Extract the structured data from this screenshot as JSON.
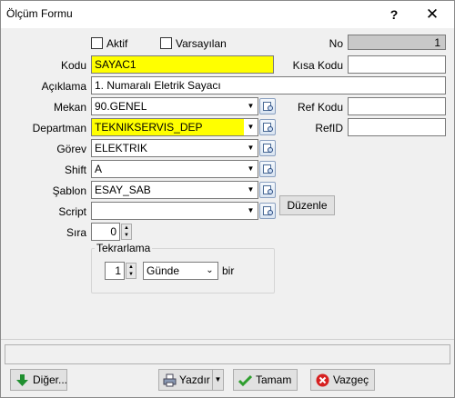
{
  "window": {
    "title": "Ölçüm Formu",
    "help_glyph": "?",
    "close_glyph": "✕"
  },
  "form": {
    "aktif": {
      "label": "Aktif",
      "checked": false
    },
    "varsayilan": {
      "label": "Varsayılan",
      "checked": false
    },
    "no": {
      "label": "No",
      "value": "1"
    },
    "kod": {
      "label": "Kodu",
      "value": "SAYAC1"
    },
    "kisa_kod": {
      "label": "Kısa Kodu",
      "value": ""
    },
    "aciklama": {
      "label": "Açıklama",
      "value": "1. Numaralı Eletrik Sayacı"
    },
    "mekan": {
      "label": "Mekan",
      "value": "90.GENEL"
    },
    "ref_kodu": {
      "label": "Ref Kodu",
      "value": ""
    },
    "departman": {
      "label": "Departman",
      "value": "TEKNIKSERVIS_DEP"
    },
    "ref_id": {
      "label": "RefID",
      "value": ""
    },
    "gorev": {
      "label": "Görev",
      "value": "ELEKTRIK"
    },
    "shift": {
      "label": "Shift",
      "value": "A"
    },
    "sablon": {
      "label": "Şablon",
      "value": "ESAY_SAB"
    },
    "script": {
      "label": "Script",
      "value": "",
      "edit_button": "Düzenle"
    },
    "sira": {
      "label": "Sıra",
      "value": "0"
    },
    "tekrarlama": {
      "title": "Tekrarlama",
      "count": "1",
      "period": "Günde",
      "unit": "bir"
    }
  },
  "status": {
    "text": ""
  },
  "buttons": {
    "diger": "Diğer...",
    "yazdir": "Yazdır",
    "tamam": "Tamam",
    "vazgec": "Vazgeç"
  },
  "colors": {
    "required_bg": "#ffff00",
    "readonly_bg": "#c8c8c8",
    "ok_green": "#2e9e2e",
    "cancel_red": "#d62020",
    "diger_green": "#1f8f2f"
  },
  "icons": {
    "lookup": "lookup-icon",
    "diger": "down-arrow-icon",
    "yazdir": "printer-icon",
    "tamam": "checkmark-icon",
    "vazgec": "cancel-icon"
  }
}
